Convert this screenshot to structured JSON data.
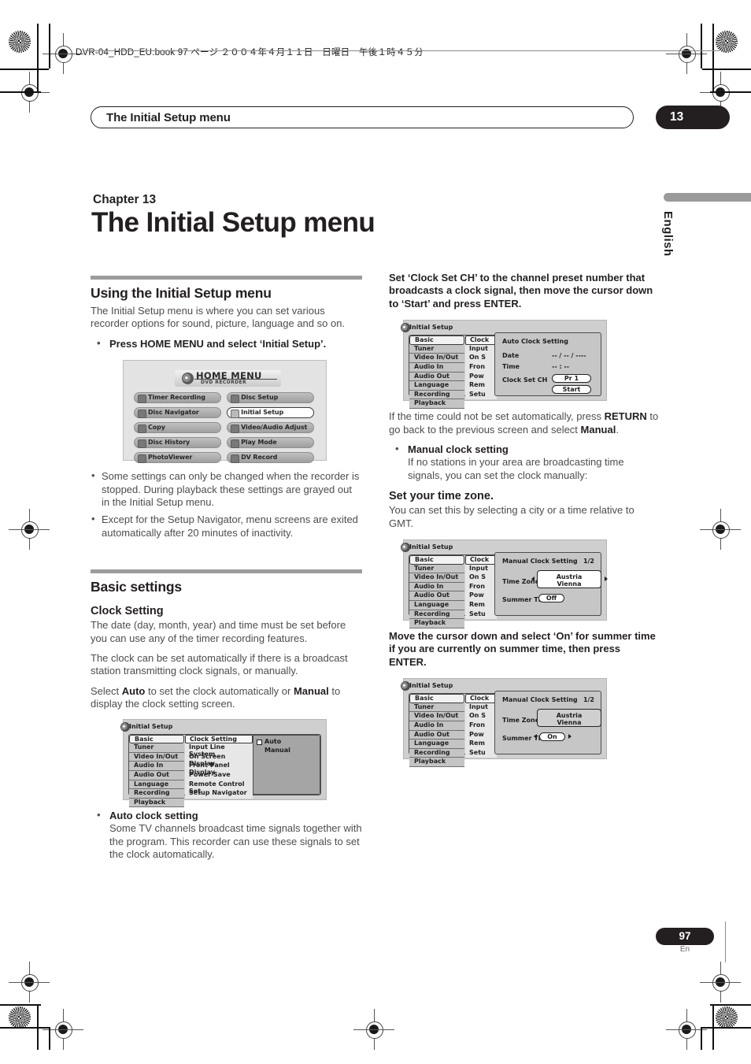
{
  "print_header": {
    "text": "DVR-04_HDD_EU.book 97 ページ ２００４年４月１１日　日曜日　午後１時４５分"
  },
  "running_head": {
    "title": "The Initial Setup menu",
    "chapter_number": "13"
  },
  "side_tab": {
    "language_label": "English"
  },
  "chapter": {
    "label": "Chapter 13",
    "title": "The Initial Setup menu"
  },
  "left_column": {
    "section1": {
      "heading": "Using the Initial Setup menu",
      "intro": "The Initial Setup menu is where you can set various recorder options for sound, picture, language and so on.",
      "instruction": "Press HOME MENU and select ‘Initial Setup’.",
      "notes": [
        "Some settings can only be changed when the recorder is stopped. During playback these settings are grayed out in the Initial Setup menu.",
        "Except for the Setup Navigator, menu screens are exited automatically after 20 minutes of inactivity."
      ]
    },
    "home_menu_screen": {
      "title": "HOME MENU",
      "subtitle": "DVD RECORDER",
      "items": [
        {
          "label": "Timer Recording",
          "icon": "timer-icon",
          "selected": false
        },
        {
          "label": "Disc Setup",
          "icon": "disc-setup-icon",
          "selected": false
        },
        {
          "label": "Disc Navigator",
          "icon": "disc-navigator-icon",
          "selected": false
        },
        {
          "label": "Initial Setup",
          "icon": "initial-setup-icon",
          "selected": true
        },
        {
          "label": "Copy",
          "icon": "copy-icon",
          "selected": false
        },
        {
          "label": "Video/Audio Adjust",
          "icon": "video-audio-adjust-icon",
          "selected": false
        },
        {
          "label": "Disc History",
          "icon": "disc-history-icon",
          "selected": false
        },
        {
          "label": "Play Mode",
          "icon": "play-mode-icon",
          "selected": false
        },
        {
          "label": "PhotoViewer",
          "icon": "photoviewer-icon",
          "selected": false
        },
        {
          "label": "DV Record",
          "icon": "dv-record-icon",
          "selected": false
        }
      ]
    },
    "section2": {
      "heading": "Basic settings",
      "subheading": "Clock Setting",
      "p1": "The date (day, month, year) and time must be set before you can use any of the timer recording features.",
      "p2": "The clock can be set automatically if there is a broadcast station transmitting clock signals, or manually.",
      "p3_pre": "Select ",
      "p3_b1": "Auto",
      "p3_mid": " to set the clock automatically or ",
      "p3_b2": "Manual",
      "p3_post": " to display the clock setting screen."
    },
    "clock_setting_screen": {
      "window_title": "Initial Setup",
      "categories": [
        "Basic",
        "Tuner",
        "Video In/Out",
        "Audio In",
        "Audio Out",
        "Language",
        "Recording",
        "Playback"
      ],
      "selected_category": "Basic",
      "menu_items": [
        "Clock Setting",
        "Input Line System",
        "On Screen Display",
        "Front Panel Display",
        "Power Save",
        "Remote Control Set",
        "Setup Navigator"
      ],
      "selected_menu_item": "Clock Setting",
      "options": [
        "Auto",
        "Manual"
      ],
      "selected_option": "Auto"
    },
    "auto_clock_note": {
      "title": "Auto clock setting",
      "body": "Some TV channels broadcast time signals together with the program. This recorder can use these signals to set the clock automatically."
    }
  },
  "right_column": {
    "intro_bold": "Set ‘Clock Set CH’ to the channel preset number that broadcasts a clock signal, then move the cursor down to ‘Start’ and press ENTER.",
    "auto_clock_screen": {
      "window_title": "Initial Setup",
      "categories": [
        "Basic",
        "Tuner",
        "Video In/Out",
        "Audio In",
        "Audio Out",
        "Language",
        "Recording",
        "Playback"
      ],
      "selected_category": "Basic",
      "menu_items": [
        "Clock",
        "Input",
        "On S",
        "Fron",
        "Pow",
        "Rem",
        "Setu"
      ],
      "selected_menu_item": "Clock",
      "panel_title": "Auto Clock Setting",
      "rows": [
        {
          "label": "Date",
          "value": "-- / -- / ----"
        },
        {
          "label": "Time",
          "value": "-- : --"
        },
        {
          "label": "Clock Set CH",
          "value": "Pr 1"
        }
      ],
      "start_button": "Start"
    },
    "p_after_auto_pre": "If the time could not be set automatically, press ",
    "p_after_auto_b1": "RETURN",
    "p_after_auto_mid": " to go back to the previous screen and select ",
    "p_after_auto_b2": "Manual",
    "p_after_auto_post": ".",
    "manual_note": {
      "title": "Manual clock setting",
      "body": "If no stations in your area are broadcasting time signals, you can set the clock manually:"
    },
    "timezone_heading": "Set your time zone.",
    "timezone_body": "You can set this by selecting a city or a time relative to GMT.",
    "manual_clock_screen_1": {
      "window_title": "Initial Setup",
      "categories": [
        "Basic",
        "Tuner",
        "Video In/Out",
        "Audio In",
        "Audio Out",
        "Language",
        "Recording",
        "Playback"
      ],
      "selected_category": "Basic",
      "menu_items": [
        "Clock",
        "Input",
        "On S",
        "Fron",
        "Pow",
        "Rem",
        "Setu"
      ],
      "panel_title": "Manual Clock Setting",
      "page_indicator": "1/2",
      "timezone_label": "Time Zone",
      "timezone_country": "Austria",
      "timezone_city": "Vienna",
      "summer_time_label": "Summer Time",
      "summer_time_value": "Off"
    },
    "summer_instruction": "Move the cursor down and select ‘On’ for summer time if you are currently on summer time, then press ENTER.",
    "manual_clock_screen_2": {
      "window_title": "Initial Setup",
      "categories": [
        "Basic",
        "Tuner",
        "Video In/Out",
        "Audio In",
        "Audio Out",
        "Language",
        "Recording",
        "Playback"
      ],
      "selected_category": "Basic",
      "menu_items": [
        "Clock",
        "Input",
        "On S",
        "Fron",
        "Pow",
        "Rem",
        "Setu"
      ],
      "panel_title": "Manual Clock Setting",
      "page_indicator": "1/2",
      "timezone_label": "Time Zone",
      "timezone_country": "Austria",
      "timezone_city": "Vienna",
      "summer_time_label": "Summer Time",
      "summer_time_value": "On"
    }
  },
  "footer": {
    "page_number": "97",
    "language_code": "En"
  }
}
